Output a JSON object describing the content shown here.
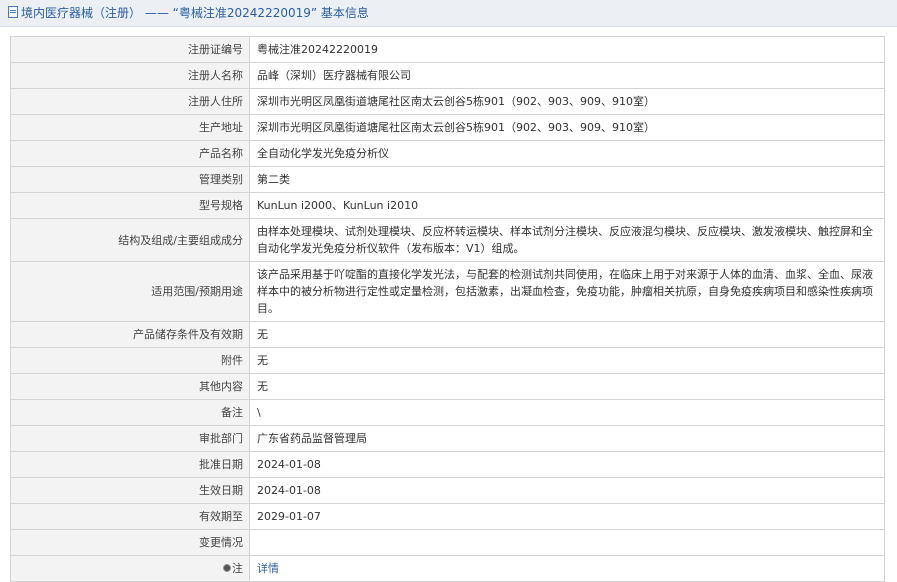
{
  "header": {
    "breadcrumb": "境内医疗器械（注册）",
    "separator": "——",
    "title": "“粤械注准20242220019” 基本信息"
  },
  "rows": [
    {
      "label": "注册证编号",
      "value": "粤械注准20242220019"
    },
    {
      "label": "注册人名称",
      "value": "品峰（深圳）医疗器械有限公司"
    },
    {
      "label": "注册人住所",
      "value": "深圳市光明区凤凰街道塘尾社区南太云创谷5栋901（902、903、909、910室）"
    },
    {
      "label": "生产地址",
      "value": "深圳市光明区凤凰街道塘尾社区南太云创谷5栋901（902、903、909、910室）"
    },
    {
      "label": "产品名称",
      "value": "全自动化学发光免疫分析仪"
    },
    {
      "label": "管理类别",
      "value": "第二类"
    },
    {
      "label": "型号规格",
      "value": "KunLun i2000、KunLun i2010"
    },
    {
      "label": "结构及组成/主要组成成分",
      "value": "由样本处理模块、试剂处理模块、反应杯转运模块、样本试剂分注模块、反应液混匀模块、反应模块、激发液模块、触控屏和全自动化学发光免疫分析仪软件（发布版本：V1）组成。"
    },
    {
      "label": "适用范围/预期用途",
      "value": "该产品采用基于吖啶酯的直接化学发光法，与配套的检测试剂共同使用，在临床上用于对来源于人体的血清、血浆、全血、尿液样本中的被分析物进行定性或定量检测，包括激素，出凝血检查，免疫功能，肿瘤相关抗原，自身免疫疾病项目和感染性疾病项目。"
    },
    {
      "label": "产品储存条件及有效期",
      "value": "无"
    },
    {
      "label": "附件",
      "value": "无"
    },
    {
      "label": "其他内容",
      "value": "无"
    },
    {
      "label": "备注",
      "value": "\\"
    },
    {
      "label": "审批部门",
      "value": "广东省药品监督管理局"
    },
    {
      "label": "批准日期",
      "value": "2024-01-08"
    },
    {
      "label": "生效日期",
      "value": "2024-01-08"
    },
    {
      "label": "有效期至",
      "value": "2029-01-07"
    },
    {
      "label": "变更情况",
      "value": ""
    }
  ],
  "note": {
    "label": "注",
    "link_text": "详情"
  }
}
